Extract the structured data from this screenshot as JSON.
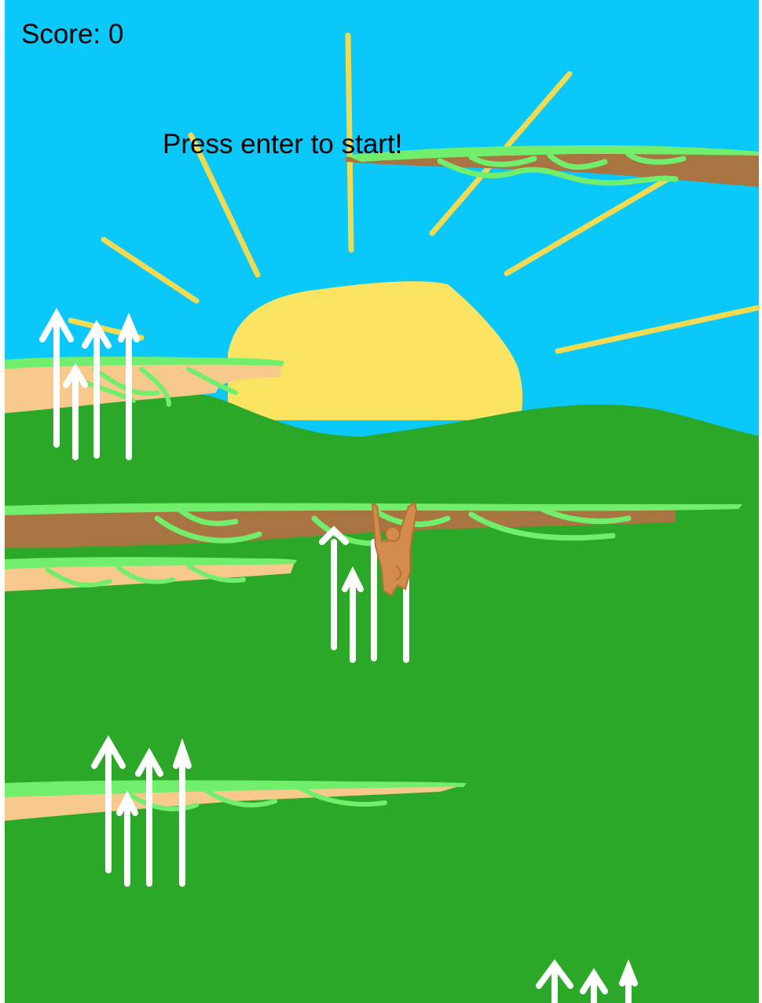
{
  "hud": {
    "score_label": "Score: 0",
    "start_prompt": "Press enter to start!"
  },
  "player": {
    "character": "monkey"
  },
  "scene": {
    "elements": [
      "sun",
      "hills",
      "vines",
      "arrow-clusters"
    ]
  },
  "colors": {
    "sky": "#0bc8fb",
    "grass": "#2ca829",
    "sun": "#fbe461",
    "sun_ray": "#f2db50",
    "vine_light": "#72ee6d",
    "branch_dark": "#a87441",
    "branch_light": "#f7c98d",
    "monkey": "#d38c4b",
    "arrow": "#ffffff"
  }
}
